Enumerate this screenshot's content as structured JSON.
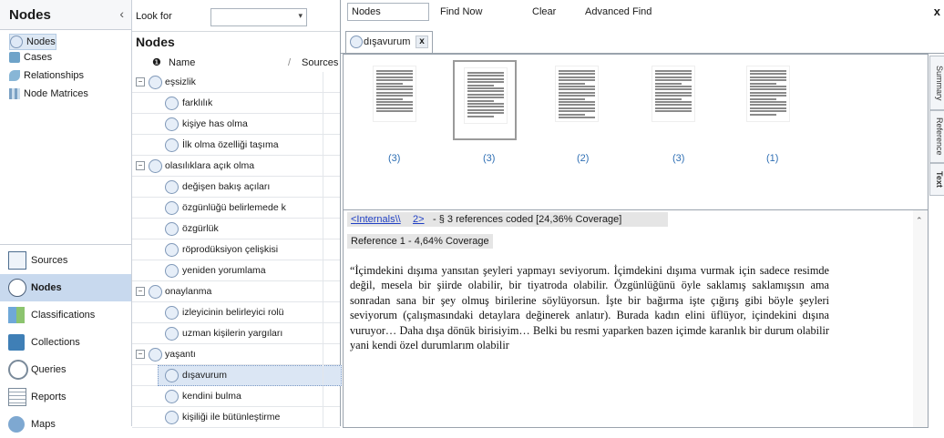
{
  "left_pane": {
    "title": "Nodes",
    "tree": [
      {
        "label": "Nodes",
        "selected": true
      },
      {
        "label": "Cases"
      },
      {
        "label": "Relationships"
      },
      {
        "label": "Node Matrices"
      }
    ],
    "nav": [
      {
        "label": "Sources"
      },
      {
        "label": "Nodes",
        "active": true
      },
      {
        "label": "Classifications"
      },
      {
        "label": "Collections"
      },
      {
        "label": "Queries"
      },
      {
        "label": "Reports"
      },
      {
        "label": "Maps"
      }
    ]
  },
  "middle_pane": {
    "look_for_label": "Look for",
    "look_for_value": "",
    "title": "Nodes",
    "col_name": "Name",
    "col_sources": "Sources",
    "nodes": [
      {
        "label": "eşsizlik",
        "level": 0
      },
      {
        "label": "farklılık",
        "level": 1
      },
      {
        "label": "kişiye has olma",
        "level": 1
      },
      {
        "label": "İlk olma özelliği taşıma",
        "level": 1
      },
      {
        "label": "olasılıklara açık olma",
        "level": 0
      },
      {
        "label": "değişen bakış açıları",
        "level": 1
      },
      {
        "label": "özgünlüğü belirlemede k",
        "level": 1
      },
      {
        "label": "özgürlük",
        "level": 1
      },
      {
        "label": "röprodüksiyon çelişkisi",
        "level": 1
      },
      {
        "label": "yeniden yorumlama",
        "level": 1
      },
      {
        "label": "onaylanma",
        "level": 0
      },
      {
        "label": "izleyicinin belirleyici rolü",
        "level": 1
      },
      {
        "label": "uzman kişilerin yargıları",
        "level": 1
      },
      {
        "label": "yaşantı",
        "level": 0
      },
      {
        "label": "dışavurum",
        "level": 1,
        "selected": true
      },
      {
        "label": "kendini bulma",
        "level": 1
      },
      {
        "label": "kişiliği ile bütünleştirme",
        "level": 1
      }
    ]
  },
  "find_bar": {
    "field_value": "Nodes",
    "find_now": "Find Now",
    "clear": "Clear",
    "advanced_find": "Advanced Find",
    "close": "x"
  },
  "doc_tab": {
    "label": "dışavurum",
    "close": "x"
  },
  "thumbnails": [
    {
      "count": "(3)"
    },
    {
      "count": "(3)",
      "selected": true
    },
    {
      "count": "(2)"
    },
    {
      "count": "(3)"
    },
    {
      "count": "(1)"
    }
  ],
  "side_tabs": [
    "Summary",
    "Reference",
    "Text"
  ],
  "document": {
    "internals_link": "<Internals\\\\",
    "num_link": "2>",
    "coverage_line": "- § 3 references coded  [24,36% Coverage]",
    "reference_1": "Reference 1 - 4,64% Coverage",
    "quote": "“İçimdekini dışıma yansıtan şeyleri yapmayı seviyorum. İçimdekini dışıma vurmak için sadece resimde değil, mesela bir şiirde olabilir, bir tiyatroda olabilir. Özgünlüğünü öyle saklamış saklamışsın ama sonradan sana bir şey olmuş birilerine söylüyorsun. İşte bir bağırma işte çığırış gibi böyle şeyleri seviyorum (çalışmasındaki detaylara değinerek anlatır). Burada kadın elini üflüyor, içindekini dışına vuruyor… Daha dışa dönük birisiyim… Belki bu resmi yaparken bazen içimde karanlık bir durum olabilir yani kendi özel durumlarım olabilir"
  }
}
